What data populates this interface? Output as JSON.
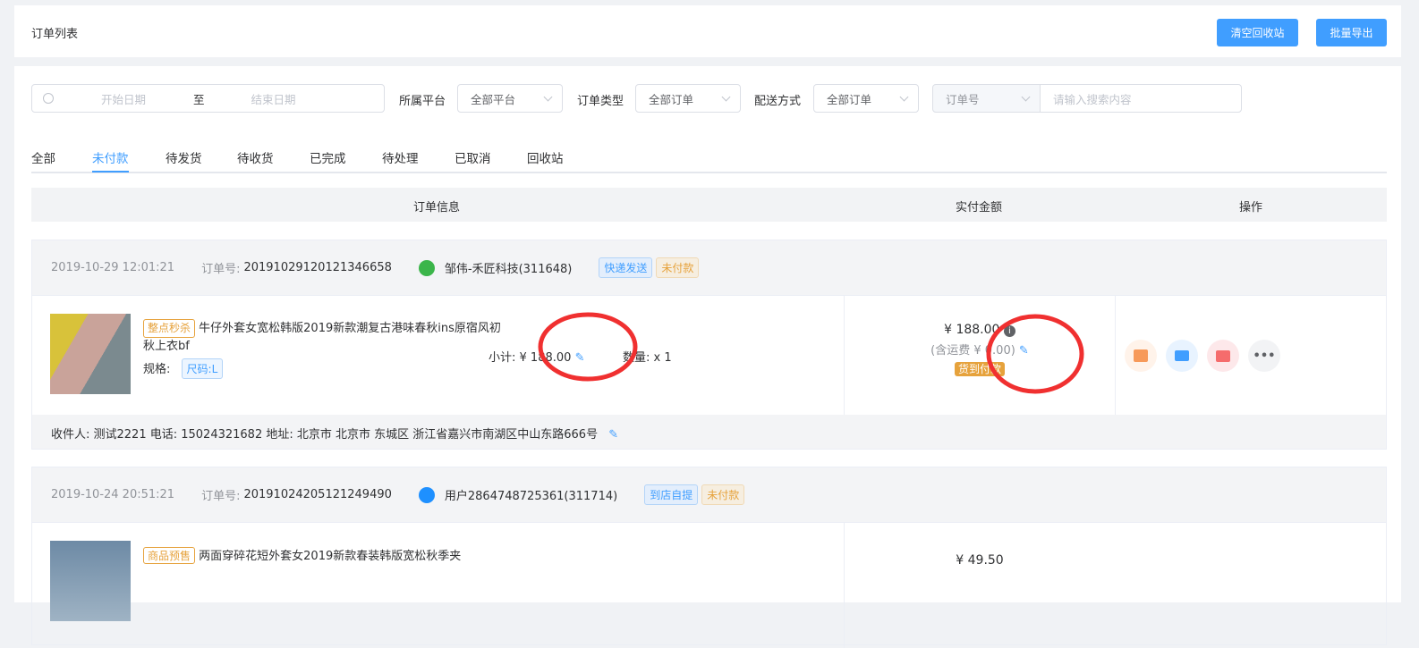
{
  "header": {
    "title": "订单列表",
    "clear_recycle_label": "清空回收站",
    "bulk_export_label": "批量导出"
  },
  "filters": {
    "start_date_placeholder": "开始日期",
    "range_separator": "至",
    "end_date_placeholder": "结束日期",
    "platform_label": "所属平台",
    "platform_value": "全部平台",
    "order_type_label": "订单类型",
    "order_type_value": "全部订单",
    "delivery_label": "配送方式",
    "delivery_value": "全部订单",
    "search_field_value": "订单号",
    "search_placeholder": "请输入搜索内容"
  },
  "tabs": [
    {
      "label": "全部"
    },
    {
      "label": "未付款",
      "active": true
    },
    {
      "label": "待发货"
    },
    {
      "label": "待收货"
    },
    {
      "label": "已完成"
    },
    {
      "label": "待处理"
    },
    {
      "label": "已取消"
    },
    {
      "label": "回收站"
    }
  ],
  "table_header": {
    "order_info": "订单信息",
    "paid_amount": "实付金额",
    "actions": "操作"
  },
  "orders": [
    {
      "time": "2019-10-29 12:01:21",
      "order_no_label": "订单号:",
      "order_no": "2019102912012134665​8",
      "buyer": "邹伟-禾匠科技(311648)",
      "platform_icon": "wechat-icon",
      "delivery_tag": "快递发送",
      "status_tag": "未付款",
      "item": {
        "promo_tag": "整点秒杀",
        "name": "牛仔外套女宽松韩版2019新款潮复古港味春秋ins原宿风初秋上衣bf",
        "spec_label": "规格:",
        "spec": "尺码:L",
        "subtotal_label": "小计:",
        "subtotal": "¥ 188.00",
        "qty_label": "数量:",
        "qty": "x 1"
      },
      "paid": "¥ 188.00",
      "shipping": "(含运费 ¥ 0.00)",
      "pay_tag": "货到付款",
      "address": "收件人: 测试2221 电话: 15024321682 地址: 北京市 北京市 东城区 浙江省嘉兴市南湖区中山东路666号"
    },
    {
      "time": "2019-10-24 20:51:21",
      "order_no_label": "订单号:",
      "order_no": "20191024205121249490",
      "buyer": "用户2864748725361(311714)",
      "platform_icon": "alipay-icon",
      "delivery_tag": "到店自提",
      "status_tag": "未付款",
      "item": {
        "promo_tag": "商品预售",
        "name": "两面穿碎花短外套女2019新款春装韩版宽松秋季夹"
      },
      "paid": "¥ 49.50"
    }
  ]
}
